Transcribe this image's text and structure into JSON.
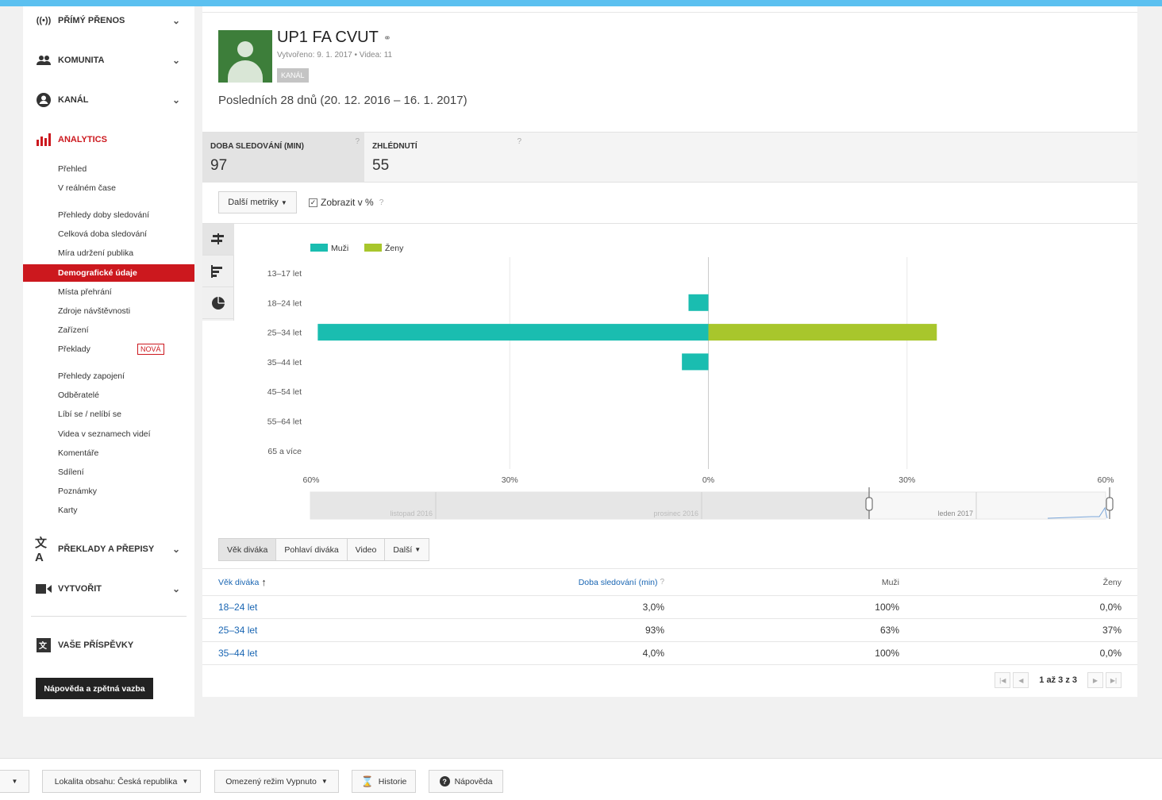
{
  "sidebar": {
    "sections": [
      {
        "label": "Přímý přenos",
        "icon": "live-broadcast-icon"
      },
      {
        "label": "Komunita",
        "icon": "community-icon"
      },
      {
        "label": "Kanál",
        "icon": "channel-icon"
      },
      {
        "label": "Analytics",
        "icon": "analytics-icon"
      }
    ],
    "analytics_items": [
      "Přehled",
      "V reálném čase",
      "Přehledy doby sledování",
      "Celková doba sledování",
      "Míra udržení publika",
      "Demografické údaje",
      "Místa přehrání",
      "Zdroje návštěvnosti",
      "Zařízení",
      "Překlady",
      "Přehledy zapojení",
      "Odběratelé",
      "Líbí se / nelíbí se",
      "Videa v seznamech videí",
      "Komentáře",
      "Sdílení",
      "Poznámky",
      "Karty"
    ],
    "new_badge": "NOVÁ",
    "lower_sections": [
      {
        "label": "Překlady a přepisy"
      },
      {
        "label": "Vytvořit"
      },
      {
        "label": "Vaše příspěvky"
      }
    ],
    "help_label": "Nápověda a zpětná vazba"
  },
  "channel": {
    "name": "UP1 FA CVUT",
    "meta": "Vytvořeno: 9. 1. 2017 • Videa: 11",
    "tag": "Kanál",
    "period": "Posledních 28 dnů (20. 12. 2016 – 16. 1. 2017)"
  },
  "metrics": [
    {
      "label": "Doba sledování (min)",
      "value": "97"
    },
    {
      "label": "Zhlédnutí",
      "value": "55"
    }
  ],
  "controls": {
    "more_metrics": "Další metriky",
    "percent_checkbox": "Zobrazit v %"
  },
  "chart_data": {
    "type": "bar",
    "orientation": "horizontal-diverging",
    "categories": [
      "13–17 let",
      "18–24 let",
      "25–34 let",
      "35–44 let",
      "45–54 let",
      "55–64 let",
      "65 a více"
    ],
    "series": [
      {
        "name": "Muži",
        "color": "#1abdb0",
        "values": [
          0,
          3.0,
          59,
          4.0,
          0,
          0,
          0
        ]
      },
      {
        "name": "Ženy",
        "color": "#a8c62c",
        "values": [
          0,
          0,
          34.5,
          0,
          0,
          0,
          0
        ]
      }
    ],
    "xticks": [
      "60%",
      "30%",
      "0%",
      "30%",
      "60%"
    ],
    "xlim": [
      -60,
      60
    ],
    "legend": "top-left",
    "timeline_labels": [
      "listopad 2016",
      "prosinec 2016",
      "leden 2017"
    ]
  },
  "table": {
    "tabs": [
      "Věk diváka",
      "Pohlaví diváka",
      "Video",
      "Další"
    ],
    "headers": [
      "Věk diváka",
      "Doba sledování (min)",
      "Muži",
      "Ženy"
    ],
    "rows": [
      [
        "18–24 let",
        "3,0%",
        "100%",
        "0,0%"
      ],
      [
        "25–34 let",
        "93%",
        "63%",
        "37%"
      ],
      [
        "35–44 let",
        "4,0%",
        "100%",
        "0,0%"
      ]
    ],
    "pager": "1 až 3 z 3"
  },
  "footer": {
    "lang_btn": "",
    "location": "Lokalita obsahu: Česká republika",
    "restricted": "Omezený režim Vypnuto",
    "history": "Historie",
    "help": "Nápověda"
  },
  "colors": {
    "accent": "#cc181e",
    "male": "#1abdb0",
    "female": "#a8c62c",
    "link": "#1a66b3"
  }
}
